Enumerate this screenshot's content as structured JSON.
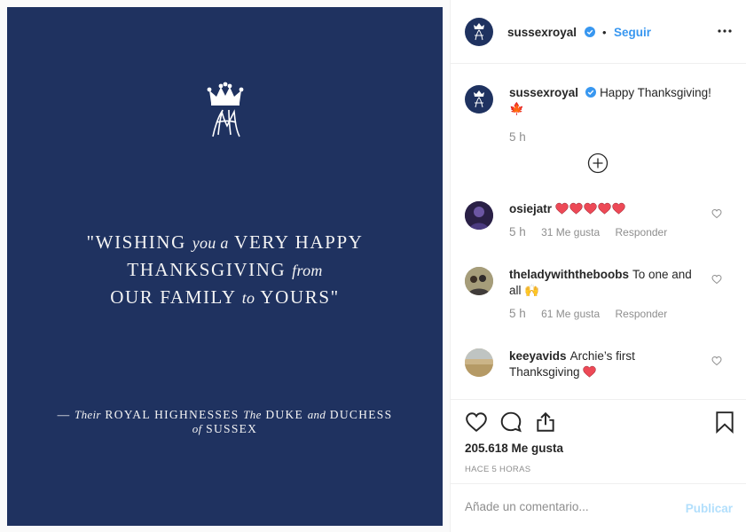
{
  "post": {
    "image_quote": {
      "line1": {
        "a": "\"WISHING ",
        "b": "you a",
        "c": " VERY HAPPY"
      },
      "line2": {
        "a": "THANKSGIVING ",
        "b": "from",
        "c": ""
      },
      "line3": {
        "a": "OUR FAMILY ",
        "b": "to",
        "c": " YOURS\""
      }
    },
    "image_signature": {
      "line1": {
        "a": "— ",
        "b": "Their",
        "c": " ROYAL HIGHNESSES ",
        "d": "The",
        "e": " DUKE ",
        "f": "and",
        "g": " DUCHESS"
      },
      "line2": {
        "a": "of",
        "b": " SUSSEX"
      }
    }
  },
  "header": {
    "username": "sussexroyal",
    "dot": "•",
    "follow_label": "Seguir",
    "icons": {
      "verified": "verified-badge-icon",
      "more": "more-options-icon"
    }
  },
  "caption": {
    "username": "sussexroyal",
    "text": "Happy Thanksgiving!",
    "emoji": "🍁",
    "time": "5 h"
  },
  "comments": [
    {
      "username": "osiejatr",
      "text": "",
      "hearts": 5,
      "time": "5 h",
      "likes": "31 Me gusta",
      "reply": "Responder"
    },
    {
      "username": "theladywiththeboobs",
      "text": "To one and all",
      "emoji": "🙌",
      "time": "5 h",
      "likes": "61 Me gusta",
      "reply": "Responder"
    },
    {
      "username": "keeyavids",
      "text": "Archie’s first Thanksgiving",
      "hearts": 1
    }
  ],
  "actions": {
    "likes": "205.618 Me gusta",
    "posted": "HACE 5 HORAS",
    "icons": [
      "heart-icon",
      "comment-icon",
      "share-icon",
      "bookmark-icon"
    ]
  },
  "comment_box": {
    "placeholder": "Añade un comentario...",
    "publish_label": "Publicar"
  },
  "colors": {
    "image_bg": "#1f3260",
    "link_blue": "#3897f0",
    "publish_disabled": "#b2dffc",
    "heart_red": "#ed4956"
  }
}
